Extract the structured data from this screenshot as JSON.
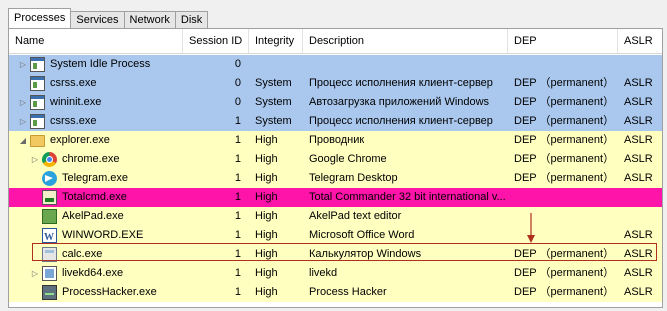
{
  "tabs": [
    "Processes",
    "Services",
    "Network",
    "Disk"
  ],
  "columns": {
    "name": "Name",
    "session": "Session ID",
    "integrity": "Integrity",
    "description": "Description",
    "dep": "DEP",
    "aslr": "ASLR"
  },
  "rows": [
    {
      "name": "System Idle Process",
      "session": "0",
      "integrity": "",
      "description": "",
      "dep": "",
      "aslr": "",
      "icon": "window-icon",
      "color": "#aac8ee",
      "expander": "collapsed"
    },
    {
      "name": "csrss.exe",
      "session": "0",
      "integrity": "System",
      "description": "Процесс исполнения клиент-сервер",
      "dep": "DEP （permanent）",
      "aslr": "ASLR",
      "icon": "window-icon",
      "color": "#aac8ee",
      "expander": ""
    },
    {
      "name": "wininit.exe",
      "session": "0",
      "integrity": "System",
      "description": "Автозагрузка приложений Windows",
      "dep": "DEP （permanent）",
      "aslr": "ASLR",
      "icon": "window-icon",
      "color": "#aac8ee",
      "expander": "collapsed"
    },
    {
      "name": "csrss.exe",
      "session": "1",
      "integrity": "System",
      "description": "Процесс исполнения клиент-сервер",
      "dep": "DEP （permanent）",
      "aslr": "ASLR",
      "icon": "window-icon",
      "color": "#aac8ee",
      "expander": "collapsed"
    },
    {
      "name": "explorer.exe",
      "session": "1",
      "integrity": "High",
      "description": "Проводник",
      "dep": "DEP （permanent）",
      "aslr": "ASLR",
      "icon": "folder-icon",
      "color": "#ffffc0",
      "expander": "expanded"
    },
    {
      "name": "chrome.exe",
      "session": "1",
      "integrity": "High",
      "description": "Google Chrome",
      "dep": "DEP （permanent）",
      "aslr": "ASLR",
      "icon": "chrome-icon",
      "color": "#ffffc0",
      "expander": "collapsed"
    },
    {
      "name": "Telegram.exe",
      "session": "1",
      "integrity": "High",
      "description": "Telegram Desktop",
      "dep": "DEP （permanent）",
      "aslr": "ASLR",
      "icon": "telegram-icon",
      "color": "#ffffc0",
      "expander": ""
    },
    {
      "name": "Totalcmd.exe",
      "session": "1",
      "integrity": "High",
      "description": "Total Commander 32 bit international v...",
      "dep": "",
      "aslr": "",
      "icon": "totalcmd-icon",
      "color": "#ff14aa",
      "expander": ""
    },
    {
      "name": "AkelPad.exe",
      "session": "1",
      "integrity": "High",
      "description": "AkelPad text editor",
      "dep": "",
      "aslr": "",
      "icon": "akelpad-icon",
      "color": "#ffffc0",
      "expander": ""
    },
    {
      "name": "WINWORD.EXE",
      "session": "1",
      "integrity": "High",
      "description": "Microsoft Office Word",
      "dep": "",
      "aslr": "ASLR",
      "icon": "word-icon",
      "color": "#ffffc0",
      "expander": ""
    },
    {
      "name": "calc.exe",
      "session": "1",
      "integrity": "High",
      "description": "Калькулятор Windows",
      "dep": "DEP （permanent）",
      "aslr": "ASLR",
      "icon": "calculator-icon",
      "color": "#ffffc0",
      "expander": ""
    },
    {
      "name": "livekd64.exe",
      "session": "1",
      "integrity": "High",
      "description": "livekd",
      "dep": "DEP （permanent）",
      "aslr": "ASLR",
      "icon": "livekd-icon",
      "color": "#ffffc0",
      "expander": "collapsed"
    },
    {
      "name": "ProcessHacker.exe",
      "session": "1",
      "integrity": "High",
      "description": "Process Hacker",
      "dep": "DEP （permanent）",
      "aslr": "ASLR",
      "icon": "processhacker-icon",
      "color": "#ffffc0",
      "expander": ""
    }
  ],
  "annotation": {
    "color": "#b03020"
  }
}
